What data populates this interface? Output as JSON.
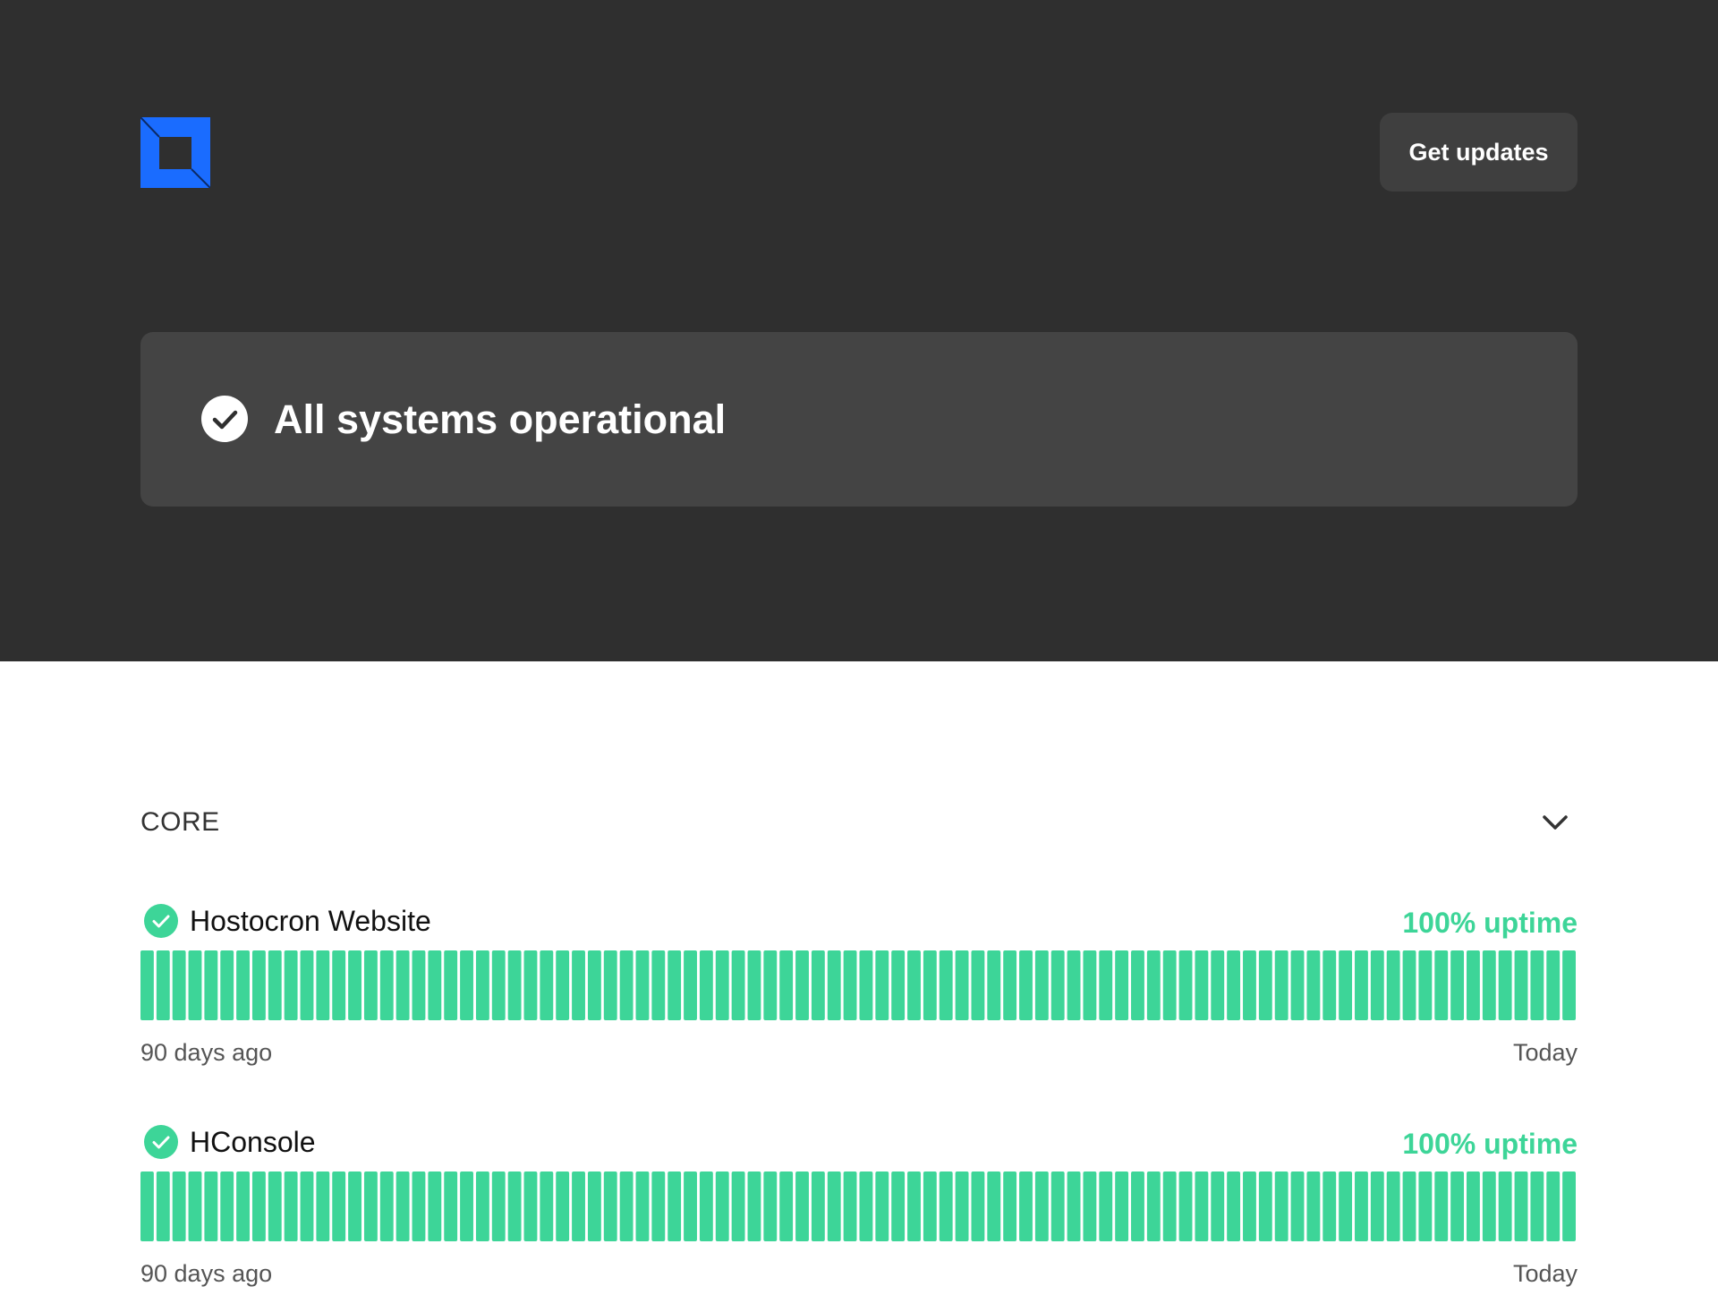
{
  "header": {
    "logo_icon": "brand-square-logo",
    "brand_color": "#1a6cff",
    "get_updates_label": "Get updates"
  },
  "status": {
    "icon": "check-circle-icon",
    "text": "All systems operational"
  },
  "groups": [
    {
      "title": "CORE",
      "expand_icon": "chevron-down-icon",
      "components": [
        {
          "name": "Hostocron Website",
          "uptime": "100% uptime",
          "status": "operational",
          "range_start": "90 days ago",
          "range_end": "Today",
          "days": 90,
          "operational_days": 90
        },
        {
          "name": "HConsole",
          "uptime": "100% uptime",
          "status": "operational",
          "range_start": "90 days ago",
          "range_end": "Today",
          "days": 90,
          "operational_days": 90
        }
      ]
    }
  ],
  "colors": {
    "hero_bg": "#2f2f2f",
    "banner_bg": "#444444",
    "operational": "#3dd598"
  }
}
